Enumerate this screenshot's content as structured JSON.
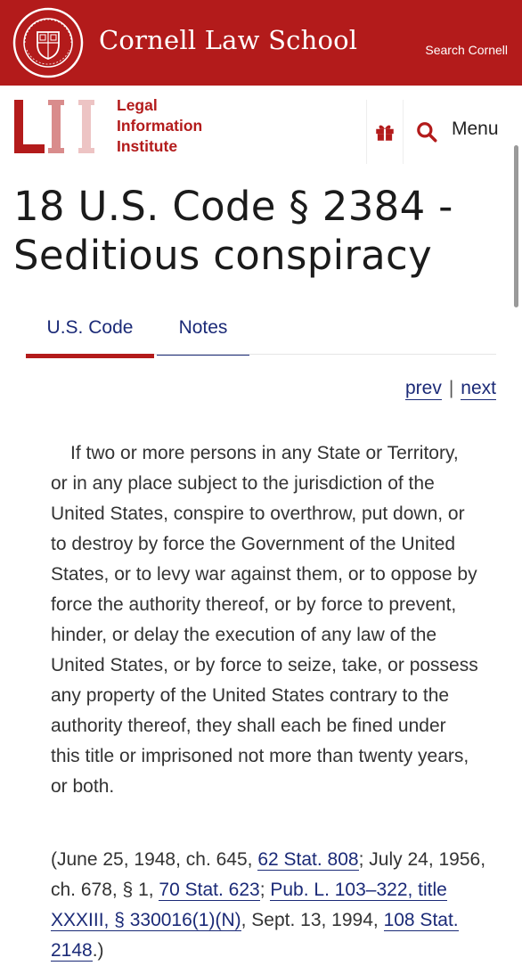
{
  "header": {
    "school_name": "Cornell Law School",
    "search_link": "Search Cornell",
    "brand_color": "#b31b1b"
  },
  "lii": {
    "logo_letters": "LII",
    "name_lines": [
      "Legal",
      "Information",
      "Institute"
    ],
    "gift_icon": "gift-icon",
    "search_icon": "search-icon",
    "menu_label": "Menu"
  },
  "page": {
    "title": "18 U.S. Code § 2384 - Seditious conspiracy"
  },
  "tabs": [
    {
      "label": "U.S. Code",
      "active": true
    },
    {
      "label": "Notes",
      "active": false
    }
  ],
  "pager": {
    "prev": "prev",
    "separator": "|",
    "next": "next"
  },
  "statute": {
    "text": "If two or more persons in any State or Territory, or in any place subject to the jurisdiction of the United States, conspire to overthrow, put down, or to destroy by force the Government of the United States, or to levy war against them, or to oppose by force the authority thereof, or by force to prevent, hinder, or delay the execution of any law of the United States, or by force to seize, take, or possess any property of the United States contrary to the authority thereof, they shall each be fined under this title or imprisoned not more than twenty years, or both."
  },
  "source_credit": {
    "part1": "(June 25, 1948, ch. 645, ",
    "link1": "62 Stat. 808",
    "part2": "; July 24, 1956, ch. 678, § 1, ",
    "link2": "70 Stat. 623",
    "part3": "; ",
    "link3": "Pub. L. 103–322, title XXXIII, § 330016(1)(N)",
    "part4": ", Sept. 13, 1994, ",
    "link4": "108 Stat. 2148",
    "part5": ".)"
  }
}
